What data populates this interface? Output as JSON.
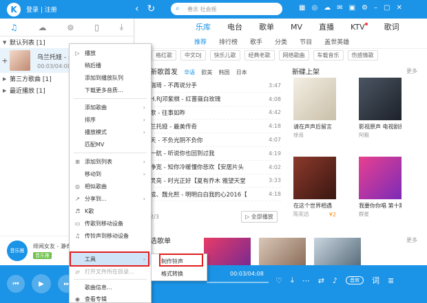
{
  "app": {
    "logo_letter": "K",
    "login": "登录 | 注册",
    "search_placeholder": "善念 社会摇",
    "brand_color": "#1b93e6"
  },
  "left_panel": {
    "groups": [
      {
        "label": "默认列表 [1]"
      },
      {
        "label": "第三方歌曲 [1]"
      },
      {
        "label": "最近播放 [1]"
      }
    ],
    "now_playing": {
      "title": "乌兰托娅 - 最",
      "time": "00:03/04:08"
    },
    "ad": {
      "text": "绯闻女友 - 瀞奇",
      "badge": "音乐推",
      "tag": "音乐推"
    }
  },
  "main_nav": {
    "tabs": [
      "乐库",
      "电台",
      "歌单",
      "MV",
      "直播",
      "KTV",
      "歌词"
    ],
    "active": "乐库"
  },
  "sub_nav": {
    "tabs": [
      "推荐",
      "排行榜",
      "歌手",
      "分类",
      "节目",
      "盖世英雄"
    ],
    "new_badge": "NEW"
  },
  "tags": [
    "格红歌",
    "中文DJ",
    "快乐儿歌",
    "经典老歌",
    "网络歌曲",
    "车载音乐",
    "伤感情歌"
  ],
  "new_songs": {
    "title": "新歌首发",
    "filters": [
      "华语",
      "欧美",
      "韩国",
      "日本"
    ],
    "rows": [
      {
        "title": "瑞琦 - 不再说分手",
        "duration": "3:47"
      },
      {
        "title": "H.RJ邓紫棋 - 红蔷薇白玫瑰",
        "duration": "4:08"
      },
      {
        "title": "歌 - 往事如昨",
        "duration": "4:42"
      },
      {
        "title": "兰托娅 - 最美传奇",
        "duration": "4:18"
      },
      {
        "title": "天 - 不负光阴不负你",
        "duration": "4:07"
      },
      {
        "title": "一航 - 听说你也回到过我",
        "duration": "4:19"
      },
      {
        "title": "净宽 - 知你冷暖懂你悲欢【安居片头",
        "duration": "4:02"
      },
      {
        "title": "灵亮 - 时光正好【夏有乔木 雅望天堂",
        "duration": "3:33"
      },
      {
        "title": "成、魏允熙 - 明明白白我的心2016【",
        "duration": "4:18"
      }
    ],
    "pager": "2/3",
    "play_all": "全部播放",
    "hot_lists_title": "选歌单"
  },
  "new_albums": {
    "title": "新碟上架",
    "more": "更多",
    "items": [
      {
        "name": "请在声声后留言",
        "artist": "徐良",
        "price": ""
      },
      {
        "name": "影视原声 电视剧原声专辑",
        "artist": "阿粗",
        "price": ""
      },
      {
        "name": "在这个世界相遇",
        "artist": "陈奕迅",
        "price": "¥2"
      },
      {
        "name": "我要你你唱 第十期",
        "artist": "群星",
        "price": ""
      }
    ]
  },
  "player": {
    "time": "00:03/04:08",
    "sound_effect": "音效",
    "lyric_btn": "词"
  },
  "context_menu": {
    "items": [
      {
        "label": "播放",
        "icon": "play-icon"
      },
      {
        "label": "稍后播"
      },
      {
        "label": "添加到播放队列"
      },
      {
        "label": "下载更多音质..."
      },
      {
        "label": "添加歌曲",
        "submenu": true
      },
      {
        "label": "排序",
        "submenu": true
      },
      {
        "label": "播放模式",
        "submenu": true
      },
      {
        "label": "匹配MV"
      },
      {
        "label": "添加到列表",
        "icon": "plus-icon",
        "submenu": true
      },
      {
        "label": "移动到",
        "submenu": true
      },
      {
        "label": "相似歌曲",
        "icon": "similar-icon"
      },
      {
        "label": "分享到...",
        "icon": "share-icon",
        "submenu": true
      },
      {
        "label": "K歌",
        "icon": "mic-icon"
      },
      {
        "label": "传歌到移动设备",
        "icon": "upload-icon"
      },
      {
        "label": "传铃声到移动设备",
        "icon": "ring-icon"
      },
      {
        "label": "工具",
        "submenu": true
      },
      {
        "label": "打开文件所在目录...",
        "icon": "folder-icon",
        "disabled": true
      },
      {
        "label": "歌曲信息..."
      },
      {
        "label": "查看专辑",
        "icon": "album-icon"
      }
    ],
    "tools_submenu": [
      "制作铃声",
      "格式转换"
    ]
  }
}
